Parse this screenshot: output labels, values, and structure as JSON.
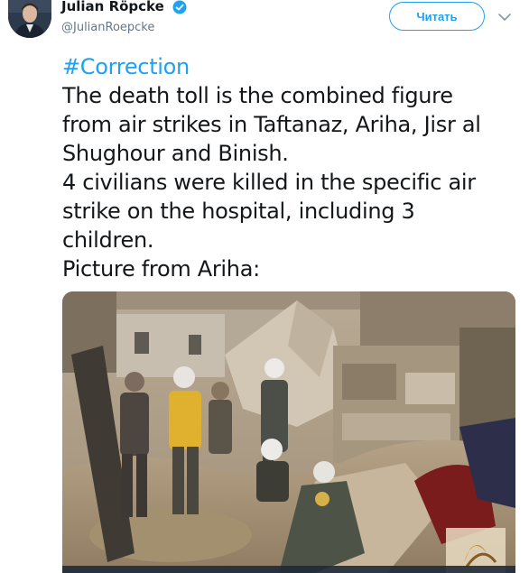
{
  "author": {
    "name": "Julian Röpcke",
    "handle": "@JulianRoepcke",
    "verified_icon": "verified-badge-icon"
  },
  "actions": {
    "follow_label": "Читать",
    "more_icon": "chevron-down-icon"
  },
  "tweet": {
    "hashtag": "#Correction",
    "lines": [
      "The death toll is the combined figure",
      "from air strikes in Taftanaz, Ariha, Jisr al",
      "Shughour and Binish.",
      "4 civilians were killed in the specific air",
      "strike on the hospital, including 3",
      "children.",
      "Picture from Ariha:"
    ]
  },
  "media": {
    "kind": "photo",
    "subject": "rubble-rescue-photo"
  },
  "colors": {
    "accent": "#1da1f2",
    "text": "#14171a",
    "secondary": "#657786"
  }
}
